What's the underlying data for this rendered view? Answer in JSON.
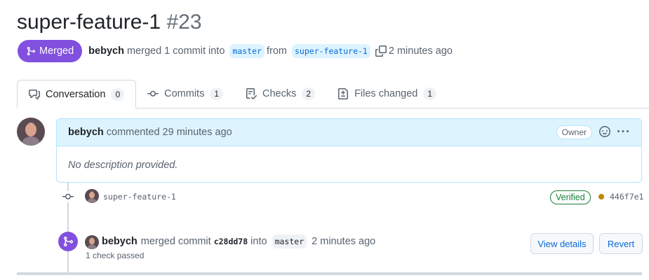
{
  "pr": {
    "title": "super-feature-1",
    "number": "#23",
    "state_label": "Merged",
    "author": "bebych",
    "merge_text": "merged 1 commit into",
    "base_branch": "master",
    "from_text": "from",
    "head_branch": "super-feature-1",
    "time": "2 minutes ago"
  },
  "tabs": [
    {
      "label": "Conversation",
      "count": "0",
      "icon": "comment-discussion-icon"
    },
    {
      "label": "Commits",
      "count": "1",
      "icon": "git-commit-icon"
    },
    {
      "label": "Checks",
      "count": "2",
      "icon": "checklist-icon"
    },
    {
      "label": "Files changed",
      "count": "1",
      "icon": "file-diff-icon"
    }
  ],
  "comment": {
    "author": "bebych",
    "action": "commented 29 minutes ago",
    "role_badge": "Owner",
    "body": "No description provided."
  },
  "commit": {
    "message": "super-feature-1",
    "verified_label": "Verified",
    "sha": "446f7e1"
  },
  "merge_event": {
    "author": "bebych",
    "text": "merged commit",
    "sha": "c28dd78",
    "into_text": "into",
    "branch": "master",
    "time": "2 minutes ago",
    "checks": "1 check passed",
    "view_details_label": "View details",
    "revert_label": "Revert"
  },
  "colors": {
    "merged_purple": "#8250df",
    "link_blue": "#0969da",
    "verified_green": "#1a7f37",
    "pending_yellow": "#bf8700"
  }
}
